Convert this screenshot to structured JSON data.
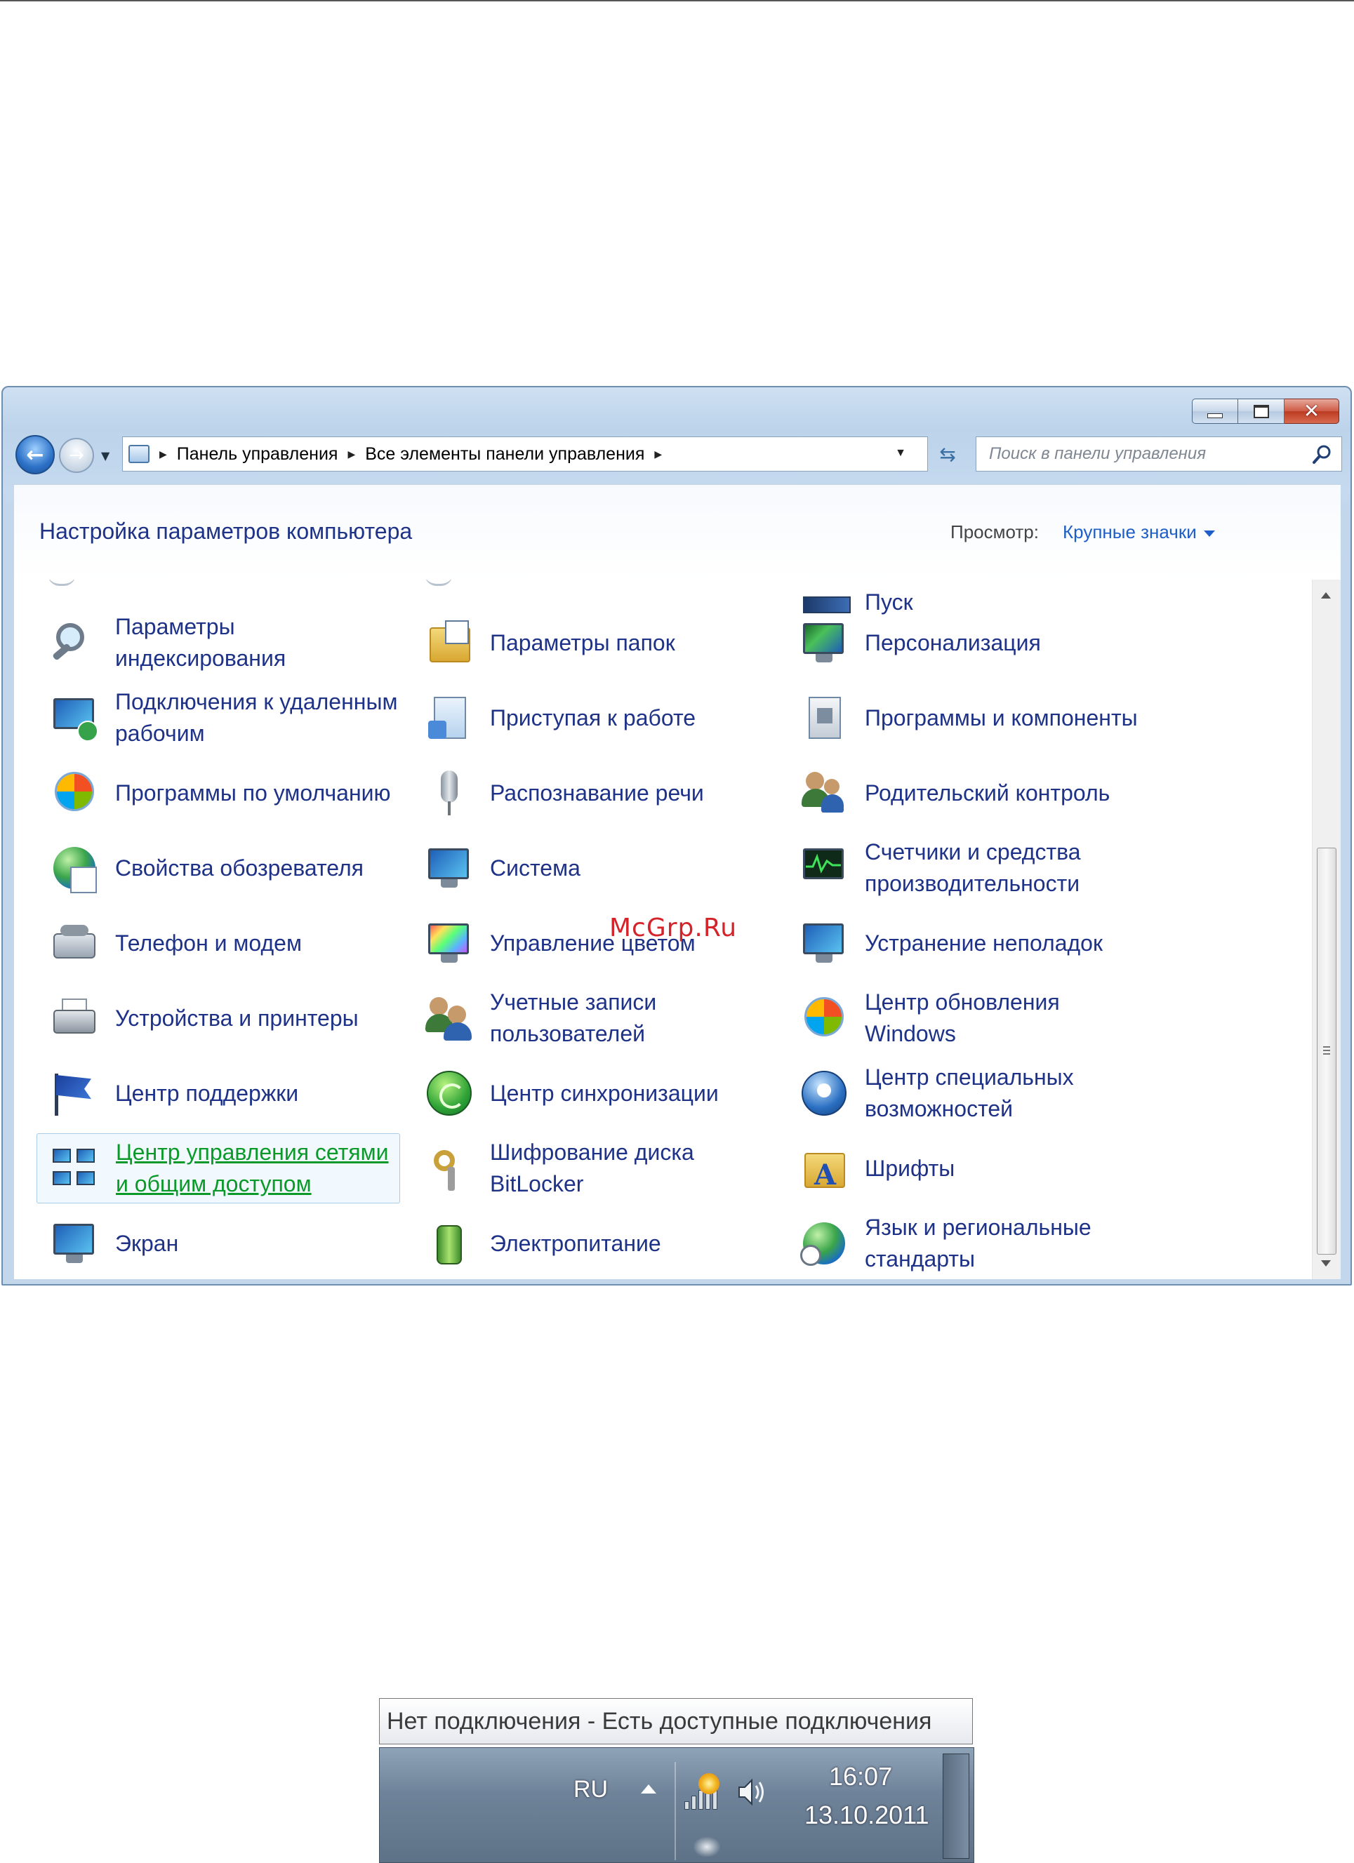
{
  "window": {
    "breadcrumb": [
      "Панель управления",
      "Все элементы панели управления"
    ],
    "search_placeholder": "Поиск в панели управления",
    "page_title": "Настройка параметров компьютера",
    "view_label": "Просмотр:",
    "view_value": "Крупные значки",
    "partial_top_item": "Пуск"
  },
  "items": [
    {
      "label": "Параметры индексирования",
      "icon": "indexing-icon"
    },
    {
      "label": "Параметры папок",
      "icon": "folder-options-icon"
    },
    {
      "label": "Персонализация",
      "icon": "personalization-icon"
    },
    {
      "label": "Подключения к удаленным рабочим",
      "icon": "remote-desktop-icon"
    },
    {
      "label": "Приступая к работе",
      "icon": "getting-started-icon"
    },
    {
      "label": "Программы и компоненты",
      "icon": "programs-features-icon"
    },
    {
      "label": "Программы по умолчанию",
      "icon": "default-programs-icon"
    },
    {
      "label": "Распознавание речи",
      "icon": "microphone-icon"
    },
    {
      "label": "Родительский контроль",
      "icon": "parental-controls-icon"
    },
    {
      "label": "Свойства обозревателя",
      "icon": "internet-options-icon"
    },
    {
      "label": "Система",
      "icon": "system-icon"
    },
    {
      "label": "Счетчики и средства производительности",
      "icon": "performance-icon"
    },
    {
      "label": "Телефон и модем",
      "icon": "phone-modem-icon"
    },
    {
      "label": "Управление цветом",
      "icon": "color-management-icon"
    },
    {
      "label": "Устранение неполадок",
      "icon": "troubleshooting-icon"
    },
    {
      "label": "Устройства и принтеры",
      "icon": "printer-icon"
    },
    {
      "label": "Учетные записи пользователей",
      "icon": "user-accounts-icon"
    },
    {
      "label": "Центр обновления Windows",
      "icon": "windows-update-icon"
    },
    {
      "label": "Центр поддержки",
      "icon": "action-center-flag-icon"
    },
    {
      "label": "Центр синхронизации",
      "icon": "sync-center-icon"
    },
    {
      "label": "Центр специальных возможностей",
      "icon": "ease-of-access-icon"
    },
    {
      "label": "Центр управления сетями и общим доступом",
      "icon": "network-center-icon",
      "selected": true
    },
    {
      "label": "Шифрование диска BitLocker",
      "icon": "bitlocker-icon"
    },
    {
      "label": "Шрифты",
      "icon": "fonts-icon"
    },
    {
      "label": "Экран",
      "icon": "display-icon"
    },
    {
      "label": "Электропитание",
      "icon": "power-options-icon"
    },
    {
      "label": "Язык и региональные стандарты",
      "icon": "region-language-icon"
    }
  ],
  "watermark": "McGrp.Ru",
  "tray": {
    "tooltip": "Нет подключения - Есть доступные подключения",
    "language": "RU",
    "time": "16:07",
    "date": "13.10.2011"
  }
}
